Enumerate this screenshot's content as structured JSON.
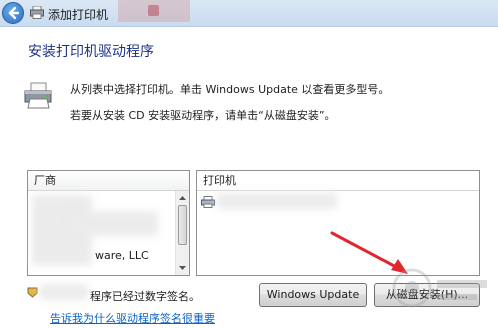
{
  "window": {
    "title": "添加打印机"
  },
  "heading": "安装打印机驱动程序",
  "description": {
    "line1": "从列表中选择打印机。单击 Windows Update 以查看更多型号。",
    "line2": "若要从安装 CD 安装驱动程序，请单击“从磁盘安装”。"
  },
  "manufacturer_list": {
    "header": "厂商",
    "visible_item": "ware, LLC"
  },
  "printer_list": {
    "header": "打印机"
  },
  "signature": {
    "text": "程序已经过数字签名。",
    "link": "告诉我为什么驱动程序签名很重要"
  },
  "buttons": {
    "windows_update": "Windows Update",
    "have_disk": "从磁盘安装(H)..."
  },
  "colors": {
    "heading": "#1e3287",
    "link": "#0b63c8",
    "annotation_arrow": "#e0262e"
  },
  "icons": [
    "back-arrow-icon",
    "printer-icon",
    "shield-icon",
    "scroll-up-icon",
    "scroll-down-icon"
  ]
}
